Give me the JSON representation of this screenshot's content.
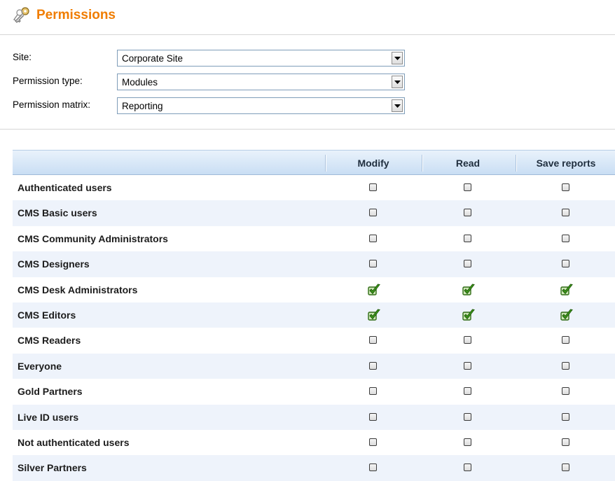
{
  "header": {
    "title": "Permissions",
    "icon": "keys-icon",
    "title_color": "#f07d00"
  },
  "filters": {
    "site": {
      "label": "Site:",
      "value": "Corporate Site"
    },
    "permission_type": {
      "label": "Permission type:",
      "value": "Modules"
    },
    "permission_matrix": {
      "label": "Permission matrix:",
      "value": "Reporting"
    }
  },
  "matrix": {
    "columns": [
      "Modify",
      "Read",
      "Save reports"
    ],
    "rows": [
      {
        "role": "Authenticated users",
        "modify": false,
        "read": false,
        "save_reports": false
      },
      {
        "role": "CMS Basic users",
        "modify": false,
        "read": false,
        "save_reports": false
      },
      {
        "role": "CMS Community Administrators",
        "modify": false,
        "read": false,
        "save_reports": false
      },
      {
        "role": "CMS Designers",
        "modify": false,
        "read": false,
        "save_reports": false
      },
      {
        "role": "CMS Desk Administrators",
        "modify": true,
        "read": true,
        "save_reports": true
      },
      {
        "role": "CMS Editors",
        "modify": true,
        "read": true,
        "save_reports": true
      },
      {
        "role": "CMS Readers",
        "modify": false,
        "read": false,
        "save_reports": false
      },
      {
        "role": "Everyone",
        "modify": false,
        "read": false,
        "save_reports": false
      },
      {
        "role": "Gold Partners",
        "modify": false,
        "read": false,
        "save_reports": false
      },
      {
        "role": "Live ID users",
        "modify": false,
        "read": false,
        "save_reports": false
      },
      {
        "role": "Not authenticated users",
        "modify": false,
        "read": false,
        "save_reports": false
      },
      {
        "role": "Silver Partners",
        "modify": false,
        "read": false,
        "save_reports": false
      }
    ],
    "colors": {
      "header_bg": "#c9def4",
      "alt_row": "#eef3fb",
      "check_green": "#3f9a1c"
    }
  }
}
